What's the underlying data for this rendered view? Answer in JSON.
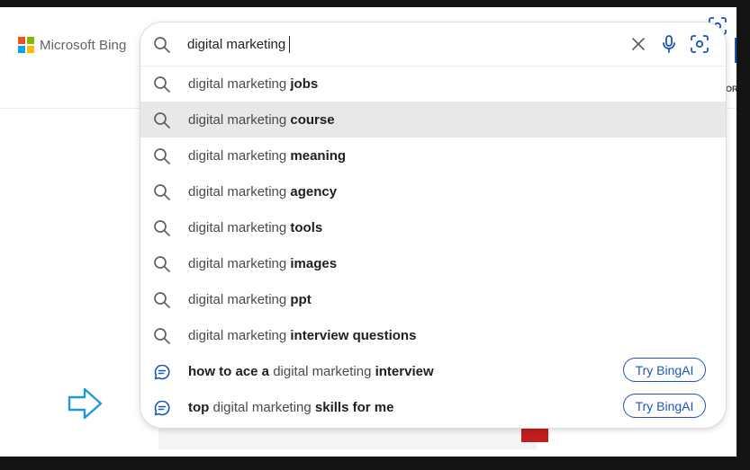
{
  "header": {
    "logo_text": "Microsoft Bing",
    "edge_tab_text": "OR"
  },
  "search": {
    "query": "digital marketing"
  },
  "suggestions": [
    {
      "prefix": "",
      "base": "digital marketing ",
      "suffix": "jobs",
      "type": "search"
    },
    {
      "prefix": "",
      "base": "digital marketing ",
      "suffix": "course",
      "type": "search",
      "highlighted": true
    },
    {
      "prefix": "",
      "base": "digital marketing ",
      "suffix": "meaning",
      "type": "search"
    },
    {
      "prefix": "",
      "base": "digital marketing ",
      "suffix": "agency",
      "type": "search"
    },
    {
      "prefix": "",
      "base": "digital marketing ",
      "suffix": "tools",
      "type": "search"
    },
    {
      "prefix": "",
      "base": "digital marketing ",
      "suffix": "images",
      "type": "search"
    },
    {
      "prefix": "",
      "base": "digital marketing ",
      "suffix": "ppt",
      "type": "search"
    },
    {
      "prefix": "",
      "base": "digital marketing ",
      "suffix": "interview questions",
      "type": "search"
    },
    {
      "prefix": "how to ace a ",
      "base": "digital marketing ",
      "suffix": "interview",
      "type": "chat",
      "button": "Try BingAI"
    },
    {
      "prefix": "top ",
      "base": "digital marketing ",
      "suffix": "skills for me",
      "type": "chat",
      "button": "Try BingAI"
    }
  ],
  "icons": {
    "search": "search-icon",
    "chat": "chat-icon",
    "clear": "close-icon",
    "mic": "microphone-icon",
    "visual_search": "visual-search-icon",
    "arrow": "arrow-right-icon"
  },
  "colors": {
    "accent": "#1a58b8",
    "highlight_row": "#e8e8e8",
    "arrow": "#1e9ad6",
    "logo_red": "#f25022",
    "logo_green": "#7fba00",
    "logo_blue": "#00a4ef",
    "logo_yellow": "#ffb900"
  }
}
